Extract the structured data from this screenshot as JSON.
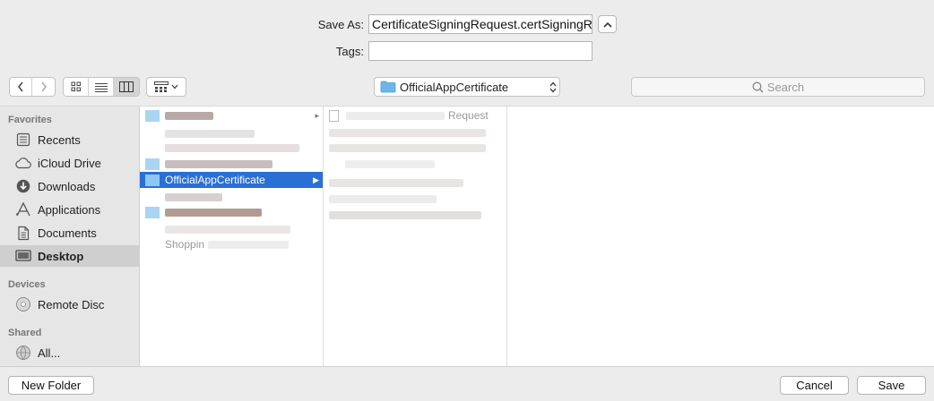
{
  "form": {
    "save_as_label": "Save As:",
    "save_as_value": "CertificateSigningRequest.certSigningRe",
    "tags_label": "Tags:",
    "tags_value": ""
  },
  "toolbar": {
    "current_folder": "OfficialAppCertificate",
    "search_placeholder": "Search"
  },
  "sidebar": {
    "favorites_header": "Favorites",
    "favorites": [
      {
        "label": "Recents",
        "icon": "recents-icon"
      },
      {
        "label": "iCloud Drive",
        "icon": "cloud-icon"
      },
      {
        "label": "Downloads",
        "icon": "download-icon"
      },
      {
        "label": "Applications",
        "icon": "applications-icon"
      },
      {
        "label": "Documents",
        "icon": "documents-icon"
      },
      {
        "label": "Desktop",
        "icon": "desktop-icon",
        "selected": true
      }
    ],
    "devices_header": "Devices",
    "devices": [
      {
        "label": "Remote Disc",
        "icon": "disc-icon"
      }
    ],
    "shared_header": "Shared",
    "shared": [
      {
        "label": "All...",
        "icon": "network-icon"
      }
    ]
  },
  "columns": {
    "col1_selected": "OfficialAppCertificate",
    "col1_partial": "Shoppin",
    "col2_partial": "Request"
  },
  "buttons": {
    "new_folder": "New Folder",
    "cancel": "Cancel",
    "save": "Save"
  },
  "colors": {
    "selection": "#2a6fd6",
    "folder": "#6cb6ec"
  }
}
